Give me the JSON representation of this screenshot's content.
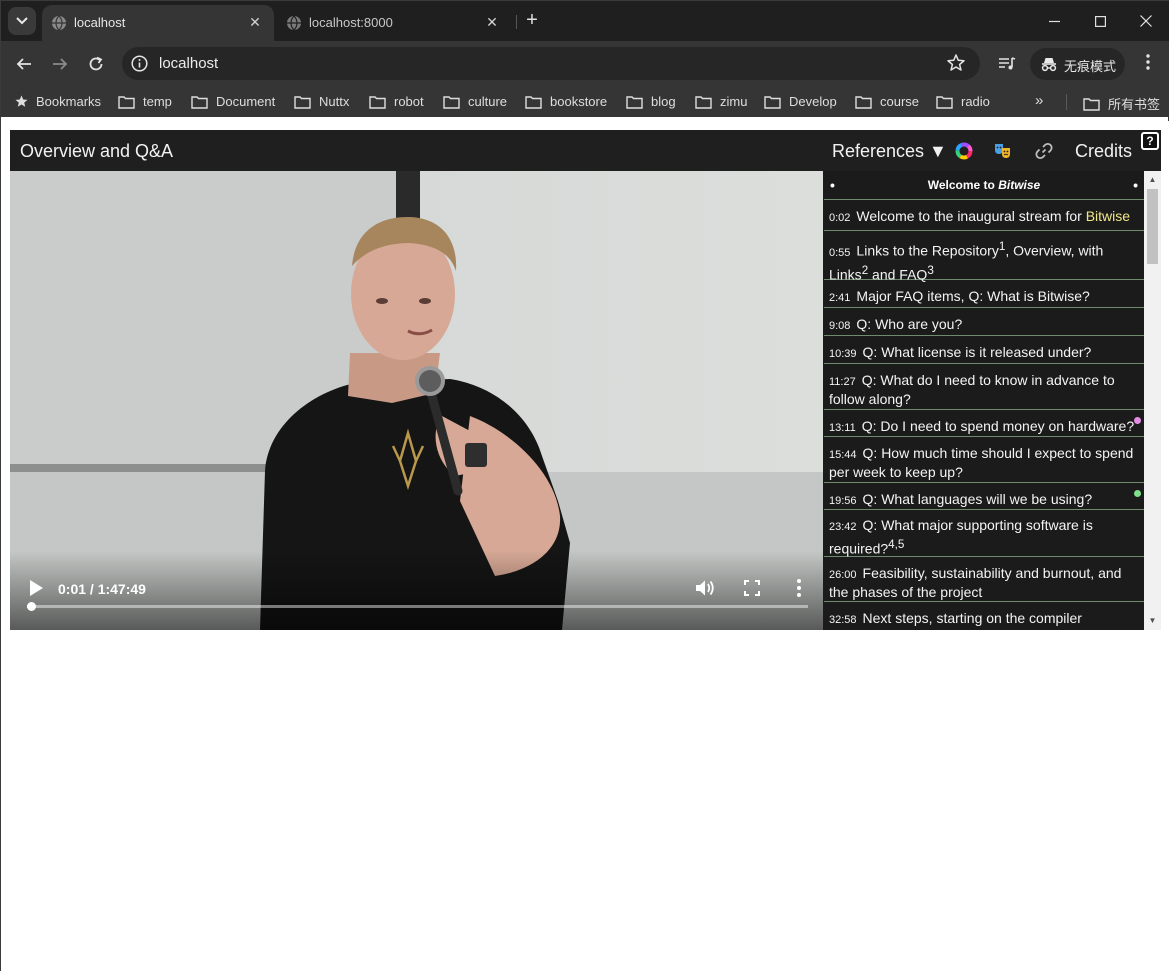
{
  "browser": {
    "tabs": [
      {
        "title": "localhost",
        "active": true
      },
      {
        "title": "localhost:8000",
        "active": false
      }
    ],
    "address": "localhost",
    "incognito_label": "无痕模式",
    "bookmarks": {
      "label": "Bookmarks",
      "folders": [
        "temp",
        "Document",
        "Nuttx",
        "robot",
        "culture",
        "bookstore",
        "blog",
        "zimu",
        "Develop",
        "course",
        "radio"
      ],
      "all_bookmarks": "所有书签"
    }
  },
  "player": {
    "title": "Overview and Q&A",
    "references_label": "References ▼",
    "credits_label": "Credits",
    "help_label": "?",
    "video": {
      "time": "0:01 / 1:47:49",
      "progress_fraction": 0.001
    },
    "sidebar": {
      "heading_prefix": "Welcome to ",
      "heading_em": "Bitwise",
      "markers": [
        {
          "ts": "0:02",
          "text": "Welcome to the inaugural stream for ",
          "hl": "Bitwise"
        },
        {
          "ts": "0:55",
          "text": "Links to the Repository",
          "sup1": "1",
          "text2": ", Overview, with Links",
          "sup2": "2",
          "text3": " and FAQ",
          "sup3": "3"
        },
        {
          "ts": "2:41",
          "text": "Major FAQ items, Q: What is Bitwise?"
        },
        {
          "ts": "9:08",
          "text": "Q: Who are you?"
        },
        {
          "ts": "10:39",
          "text": "Q: What license is it released under?"
        },
        {
          "ts": "11:27",
          "text": "Q: What do I need to know in advance to follow along?"
        },
        {
          "ts": "13:11",
          "text": "Q: Do I need to spend money on hardware?",
          "dot": "#e58be5"
        },
        {
          "ts": "15:44",
          "text": "Q: How much time should I expect to spend per week to keep up?"
        },
        {
          "ts": "19:56",
          "text": "Q: What languages will we be using?",
          "dot": "#7ee08a"
        },
        {
          "ts": "23:42",
          "text": "Q: What major supporting software is required?",
          "sup1": "4,5"
        },
        {
          "ts": "26:00",
          "text": "Feasibility, sustainability and burnout, and the phases of the project"
        },
        {
          "ts": "32:58",
          "text": "Next steps, starting on the compiler"
        }
      ]
    }
  }
}
